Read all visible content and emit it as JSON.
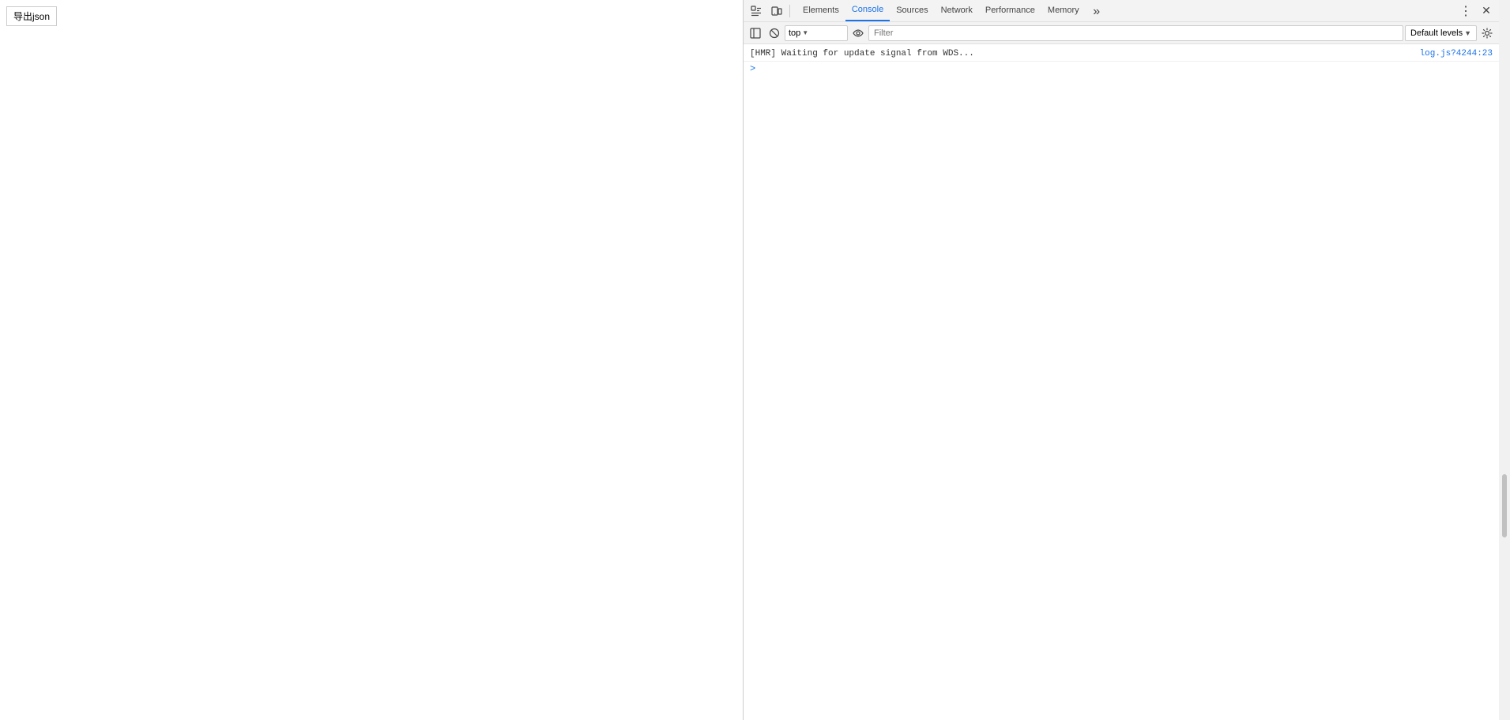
{
  "page": {
    "export_button_label": "导出json"
  },
  "devtools": {
    "tabs": [
      {
        "id": "elements",
        "label": "Elements",
        "active": false
      },
      {
        "id": "console",
        "label": "Console",
        "active": true
      },
      {
        "id": "sources",
        "label": "Sources",
        "active": false
      },
      {
        "id": "network",
        "label": "Network",
        "active": false
      },
      {
        "id": "performance",
        "label": "Performance",
        "active": false
      },
      {
        "id": "memory",
        "label": "Memory",
        "active": false
      }
    ],
    "console_toolbar": {
      "context_selector": "top",
      "filter_placeholder": "Filter",
      "default_levels": "Default levels"
    },
    "console_content": {
      "log_entry": {
        "message": "[HMR] Waiting for update signal from WDS...",
        "link": "log.js?4244:23"
      },
      "prompt_chevron": ">"
    }
  }
}
